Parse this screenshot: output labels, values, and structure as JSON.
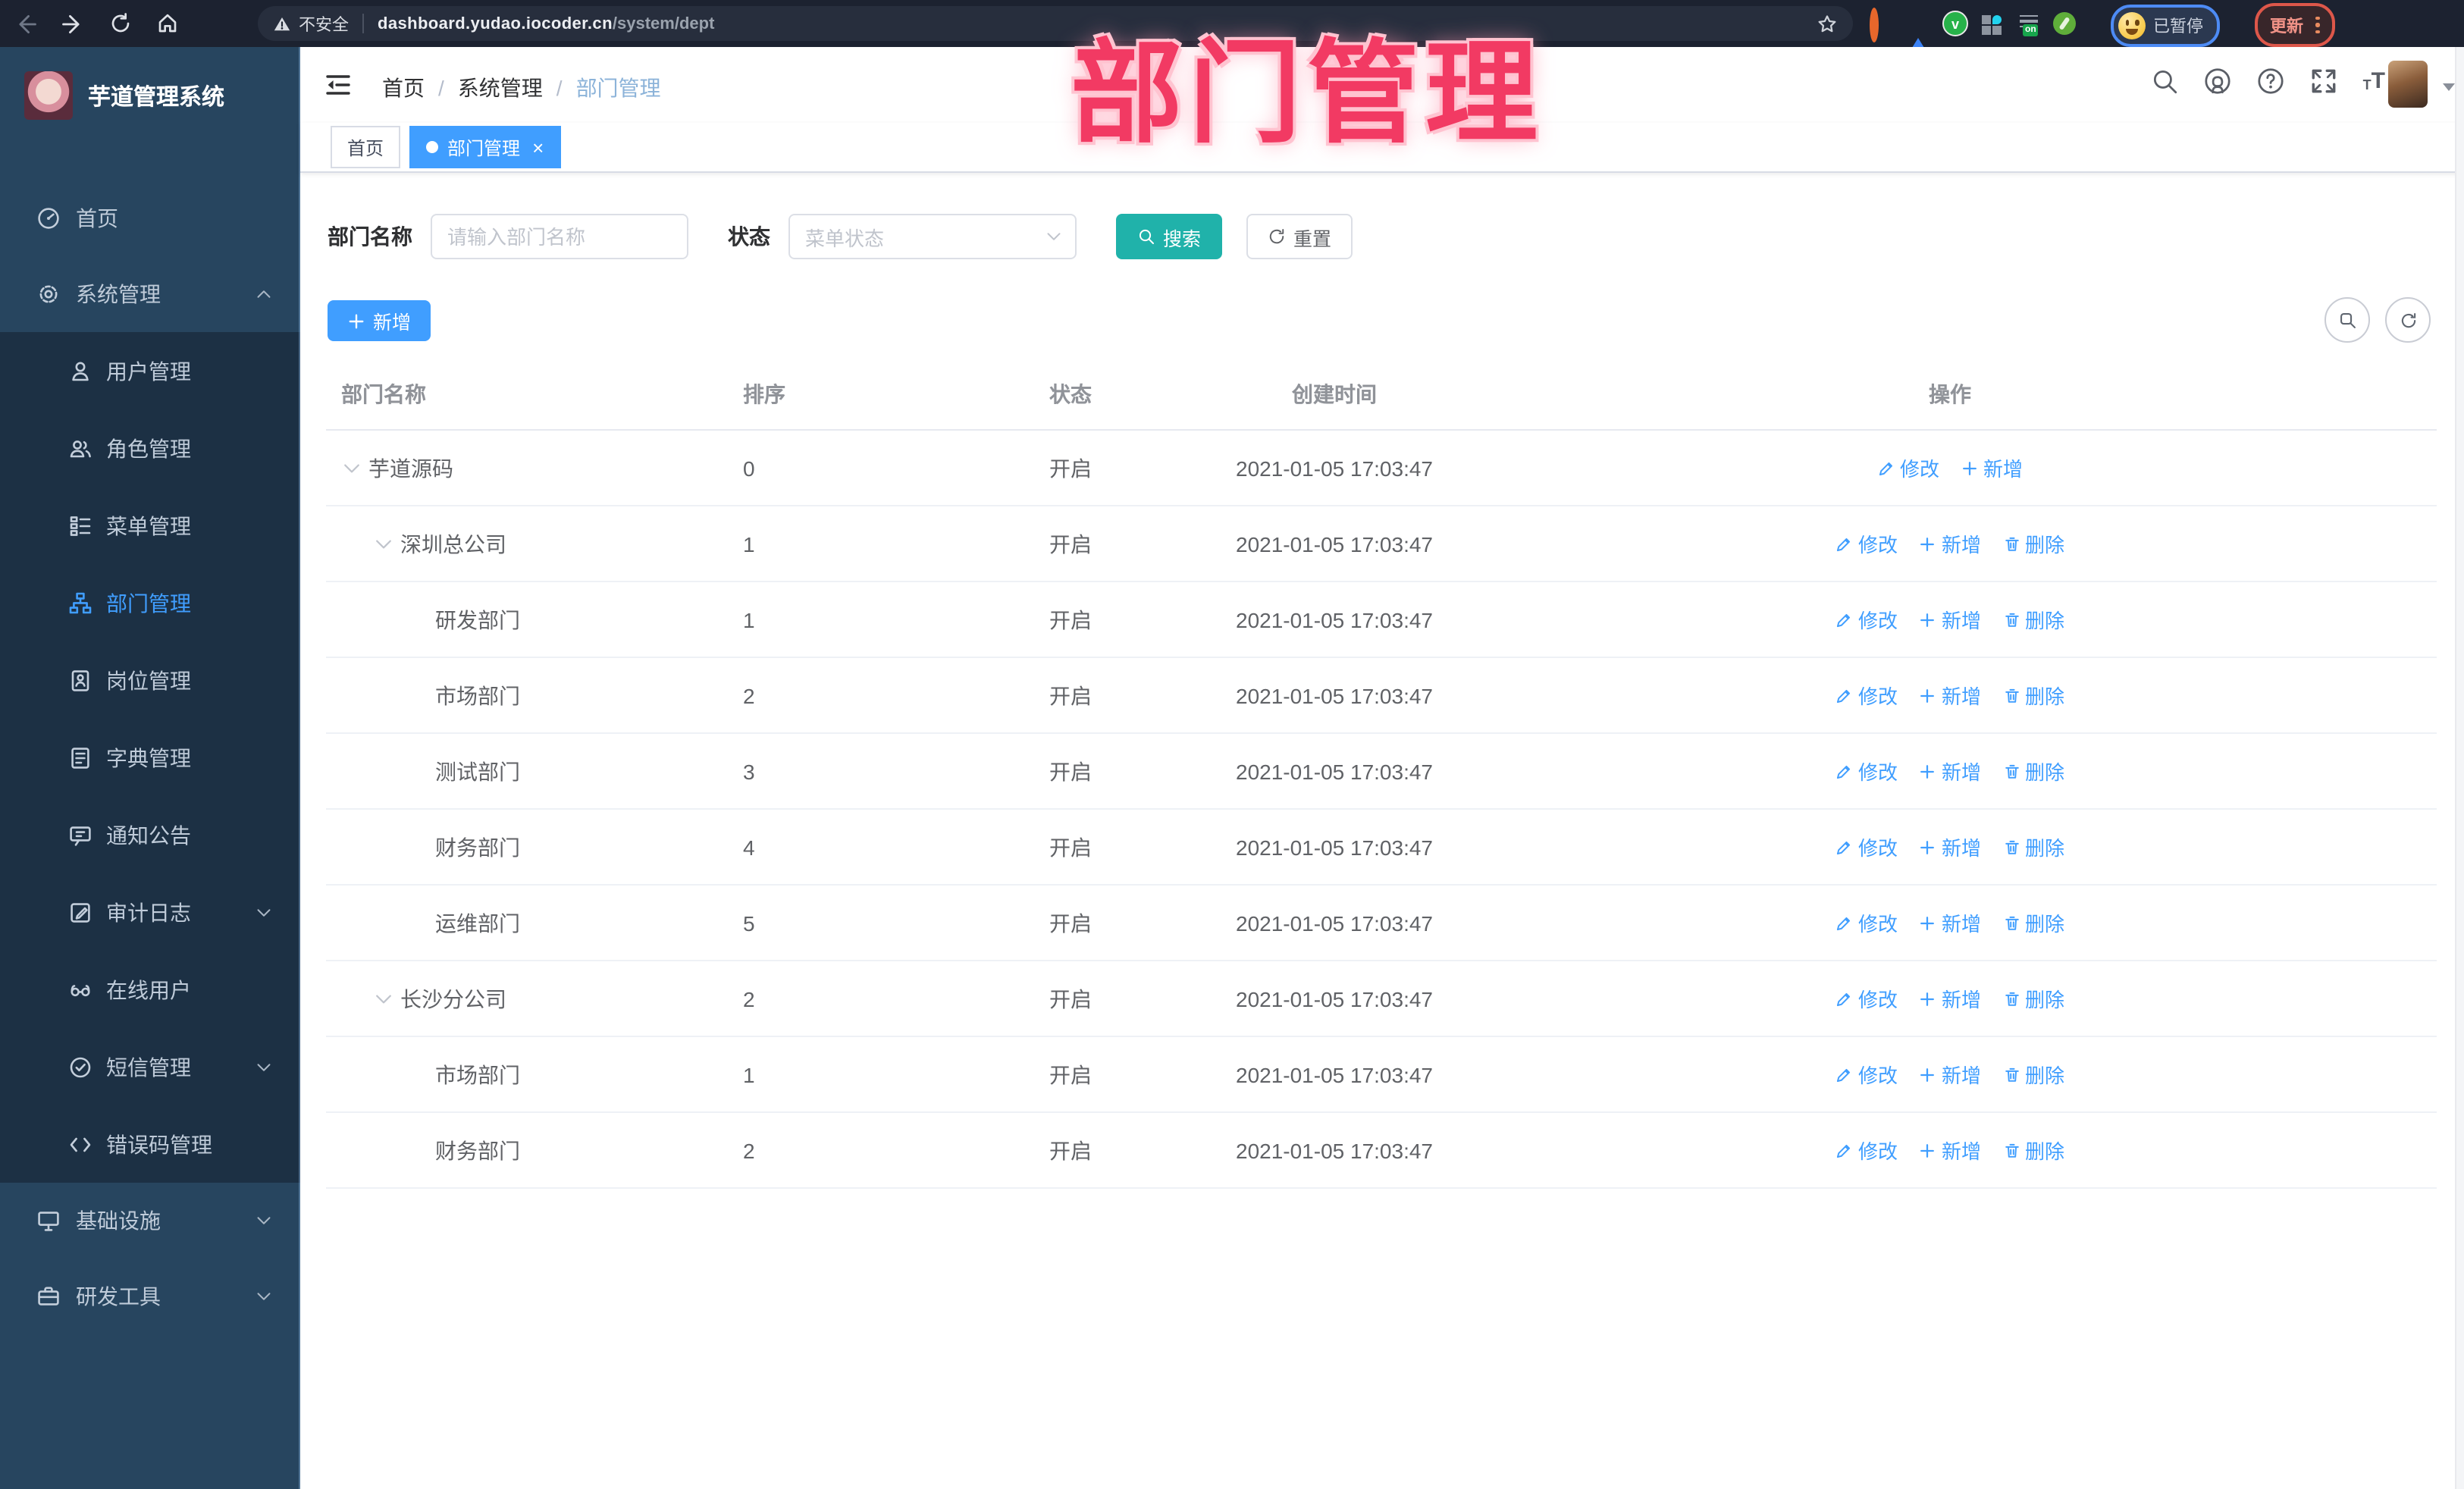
{
  "browser": {
    "security_label": "不安全",
    "url_host": "dashboard.yudao.iocoder.cn",
    "url_path": "/system/dept",
    "profile_status": "已暂停",
    "update_label": "更新",
    "extensions": [
      "orange-ring-extension-icon",
      "blue-gem-extension-icon",
      "green-check-extension-icon",
      "squares-drop-extension-icon",
      "proxy-on-extension-icon",
      "green-spoon-extension-icon",
      "puzzle-extension-icon"
    ],
    "proxy_badge": "on"
  },
  "watermark": {
    "text": "部门管理",
    "color": "#f23a63"
  },
  "sidebar": {
    "app_title": "芋道管理系统",
    "items": [
      {
        "label": "首页",
        "icon": "dashboard-icon",
        "type": "root"
      },
      {
        "label": "系统管理",
        "icon": "gear-icon",
        "type": "root",
        "arrow": "up"
      },
      {
        "label": "用户管理",
        "icon": "user-icon",
        "type": "sub"
      },
      {
        "label": "角色管理",
        "icon": "users-icon",
        "type": "sub"
      },
      {
        "label": "菜单管理",
        "icon": "menu-tree-icon",
        "type": "sub"
      },
      {
        "label": "部门管理",
        "icon": "org-tree-icon",
        "type": "sub",
        "active": true
      },
      {
        "label": "岗位管理",
        "icon": "badge-icon",
        "type": "sub"
      },
      {
        "label": "字典管理",
        "icon": "dict-book-icon",
        "type": "sub"
      },
      {
        "label": "通知公告",
        "icon": "announcement-icon",
        "type": "sub"
      },
      {
        "label": "审计日志",
        "icon": "audit-log-icon",
        "type": "sub",
        "arrow": "down"
      },
      {
        "label": "在线用户",
        "icon": "online-user-icon",
        "type": "sub"
      },
      {
        "label": "短信管理",
        "icon": "sms-check-icon",
        "type": "sub",
        "arrow": "down"
      },
      {
        "label": "错误码管理",
        "icon": "code-icon",
        "type": "sub"
      },
      {
        "label": "基础设施",
        "icon": "infra-icon",
        "type": "root",
        "arrow": "down"
      },
      {
        "label": "研发工具",
        "icon": "toolbox-icon",
        "type": "root",
        "arrow": "down"
      }
    ]
  },
  "breadcrumb": {
    "items": [
      "首页",
      "系统管理",
      "部门管理"
    ],
    "separator": "/"
  },
  "tabs": [
    {
      "label": "首页",
      "active": false
    },
    {
      "label": "部门管理",
      "active": true,
      "closable": true
    }
  ],
  "filters": {
    "dept_name_label": "部门名称",
    "dept_name_placeholder": "请输入部门名称",
    "status_label": "状态",
    "status_placeholder": "菜单状态",
    "search_label": "搜索",
    "reset_label": "重置"
  },
  "toolbar": {
    "add_label": "新增"
  },
  "table": {
    "columns": [
      "部门名称",
      "排序",
      "状态",
      "创建时间",
      "操作"
    ],
    "rows": [
      {
        "name": "芋道源码",
        "level": 0,
        "expandable": true,
        "sort": "0",
        "status": "开启",
        "created": "2021-01-05 17:03:47",
        "actions": [
          {
            "label": "修改",
            "icon": "edit-icon"
          },
          {
            "label": "新增",
            "icon": "plus-icon"
          }
        ]
      },
      {
        "name": "深圳总公司",
        "level": 1,
        "expandable": true,
        "sort": "1",
        "status": "开启",
        "created": "2021-01-05 17:03:47",
        "actions": [
          {
            "label": "修改",
            "icon": "edit-icon"
          },
          {
            "label": "新增",
            "icon": "plus-icon"
          },
          {
            "label": "删除",
            "icon": "trash-icon"
          }
        ]
      },
      {
        "name": "研发部门",
        "level": 2,
        "expandable": false,
        "sort": "1",
        "status": "开启",
        "created": "2021-01-05 17:03:47",
        "actions": [
          {
            "label": "修改",
            "icon": "edit-icon"
          },
          {
            "label": "新增",
            "icon": "plus-icon"
          },
          {
            "label": "删除",
            "icon": "trash-icon"
          }
        ]
      },
      {
        "name": "市场部门",
        "level": 2,
        "expandable": false,
        "sort": "2",
        "status": "开启",
        "created": "2021-01-05 17:03:47",
        "actions": [
          {
            "label": "修改",
            "icon": "edit-icon"
          },
          {
            "label": "新增",
            "icon": "plus-icon"
          },
          {
            "label": "删除",
            "icon": "trash-icon"
          }
        ]
      },
      {
        "name": "测试部门",
        "level": 2,
        "expandable": false,
        "sort": "3",
        "status": "开启",
        "created": "2021-01-05 17:03:47",
        "actions": [
          {
            "label": "修改",
            "icon": "edit-icon"
          },
          {
            "label": "新增",
            "icon": "plus-icon"
          },
          {
            "label": "删除",
            "icon": "trash-icon"
          }
        ]
      },
      {
        "name": "财务部门",
        "level": 2,
        "expandable": false,
        "sort": "4",
        "status": "开启",
        "created": "2021-01-05 17:03:47",
        "actions": [
          {
            "label": "修改",
            "icon": "edit-icon"
          },
          {
            "label": "新增",
            "icon": "plus-icon"
          },
          {
            "label": "删除",
            "icon": "trash-icon"
          }
        ]
      },
      {
        "name": "运维部门",
        "level": 2,
        "expandable": false,
        "sort": "5",
        "status": "开启",
        "created": "2021-01-05 17:03:47",
        "actions": [
          {
            "label": "修改",
            "icon": "edit-icon"
          },
          {
            "label": "新增",
            "icon": "plus-icon"
          },
          {
            "label": "删除",
            "icon": "trash-icon"
          }
        ]
      },
      {
        "name": "长沙分公司",
        "level": 1,
        "expandable": true,
        "sort": "2",
        "status": "开启",
        "created": "2021-01-05 17:03:47",
        "actions": [
          {
            "label": "修改",
            "icon": "edit-icon"
          },
          {
            "label": "新增",
            "icon": "plus-icon"
          },
          {
            "label": "删除",
            "icon": "trash-icon"
          }
        ]
      },
      {
        "name": "市场部门",
        "level": 2,
        "expandable": false,
        "sort": "1",
        "status": "开启",
        "created": "2021-01-05 17:03:47",
        "actions": [
          {
            "label": "修改",
            "icon": "edit-icon"
          },
          {
            "label": "新增",
            "icon": "plus-icon"
          },
          {
            "label": "删除",
            "icon": "trash-icon"
          }
        ]
      },
      {
        "name": "财务部门",
        "level": 2,
        "expandable": false,
        "sort": "2",
        "status": "开启",
        "created": "2021-01-05 17:03:47",
        "actions": [
          {
            "label": "修改",
            "icon": "edit-icon"
          },
          {
            "label": "新增",
            "icon": "plus-icon"
          },
          {
            "label": "删除",
            "icon": "trash-icon"
          }
        ]
      }
    ]
  },
  "colors": {
    "accent_blue": "#409eff",
    "search_button_teal": "#20b2aa",
    "watermark_pink": "#f23a63",
    "sidebar_bg": "#27455f",
    "submenu_bg": "#1c3044",
    "chrome_bg": "#1c2230"
  }
}
